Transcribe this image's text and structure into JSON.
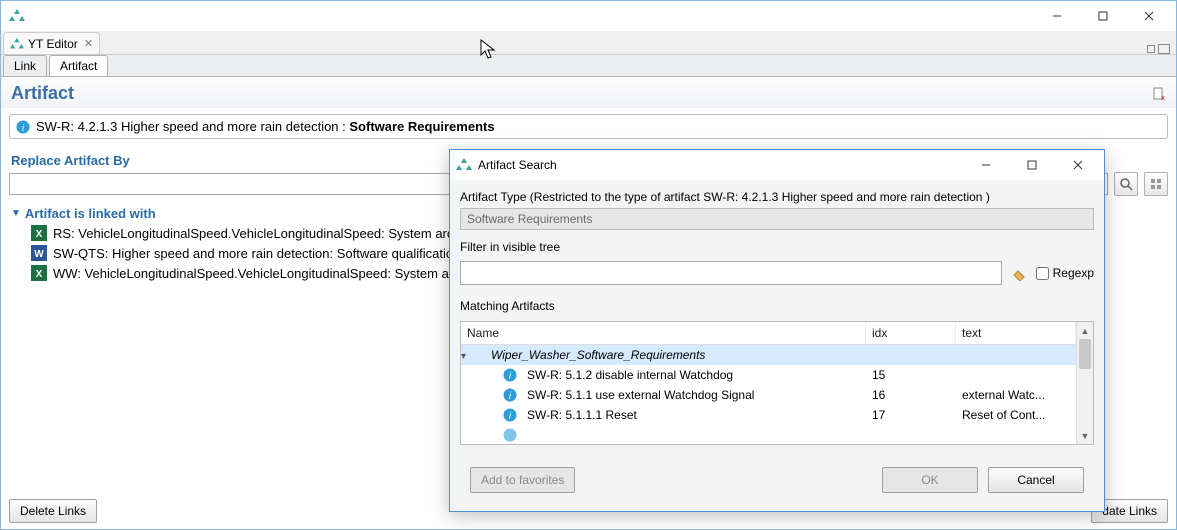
{
  "titlebar": {
    "title": ""
  },
  "editor": {
    "tab_label": "YT Editor",
    "doc_tabs": {
      "link": "Link",
      "artifact": "Artifact"
    }
  },
  "section_title": "Artifact",
  "context": {
    "prefix": "SW-R: 4.2.1.3 Higher speed and more rain detection : ",
    "category": "Software Requirements"
  },
  "replace": {
    "label": "Replace Artifact By"
  },
  "linked": {
    "label": "Artifact is linked with",
    "items": [
      "RS: VehicleLongitudinalSpeed.VehicleLongitudinalSpeed: System arch",
      "SW-QTS: Higher speed and more rain detection: Software qualificatio",
      "WW: VehicleLongitudinalSpeed.VehicleLongitudinalSpeed: System ar"
    ]
  },
  "bottom": {
    "delete_links": "Delete Links",
    "update_links": "date Links"
  },
  "dialog": {
    "title": "Artifact Search",
    "type_label": "Artifact Type (Restricted to the type of artifact SW-R: 4.2.1.3 Higher speed and more rain detection  )",
    "type_value": "Software Requirements",
    "filter_label": "Filter in visible tree",
    "regexp_label": "Regexp",
    "matching_label": "Matching Artifacts",
    "cols": {
      "name": "Name",
      "idx": "idx",
      "text": "text"
    },
    "rows": [
      {
        "name": "Wiper_Washer_Software_Requirements",
        "idx": "",
        "text": "",
        "root": true
      },
      {
        "name": "SW-R: 5.1.2 disable internal Watchdog",
        "idx": "15",
        "text": ""
      },
      {
        "name": "SW-R: 5.1.1 use external Watchdog Signal",
        "idx": "16",
        "text": "external Watc..."
      },
      {
        "name": "SW-R: 5.1.1.1 Reset",
        "idx": "17",
        "text": "Reset of Cont..."
      }
    ],
    "add_fav": "Add to favorites",
    "ok": "OK",
    "cancel": "Cancel"
  }
}
